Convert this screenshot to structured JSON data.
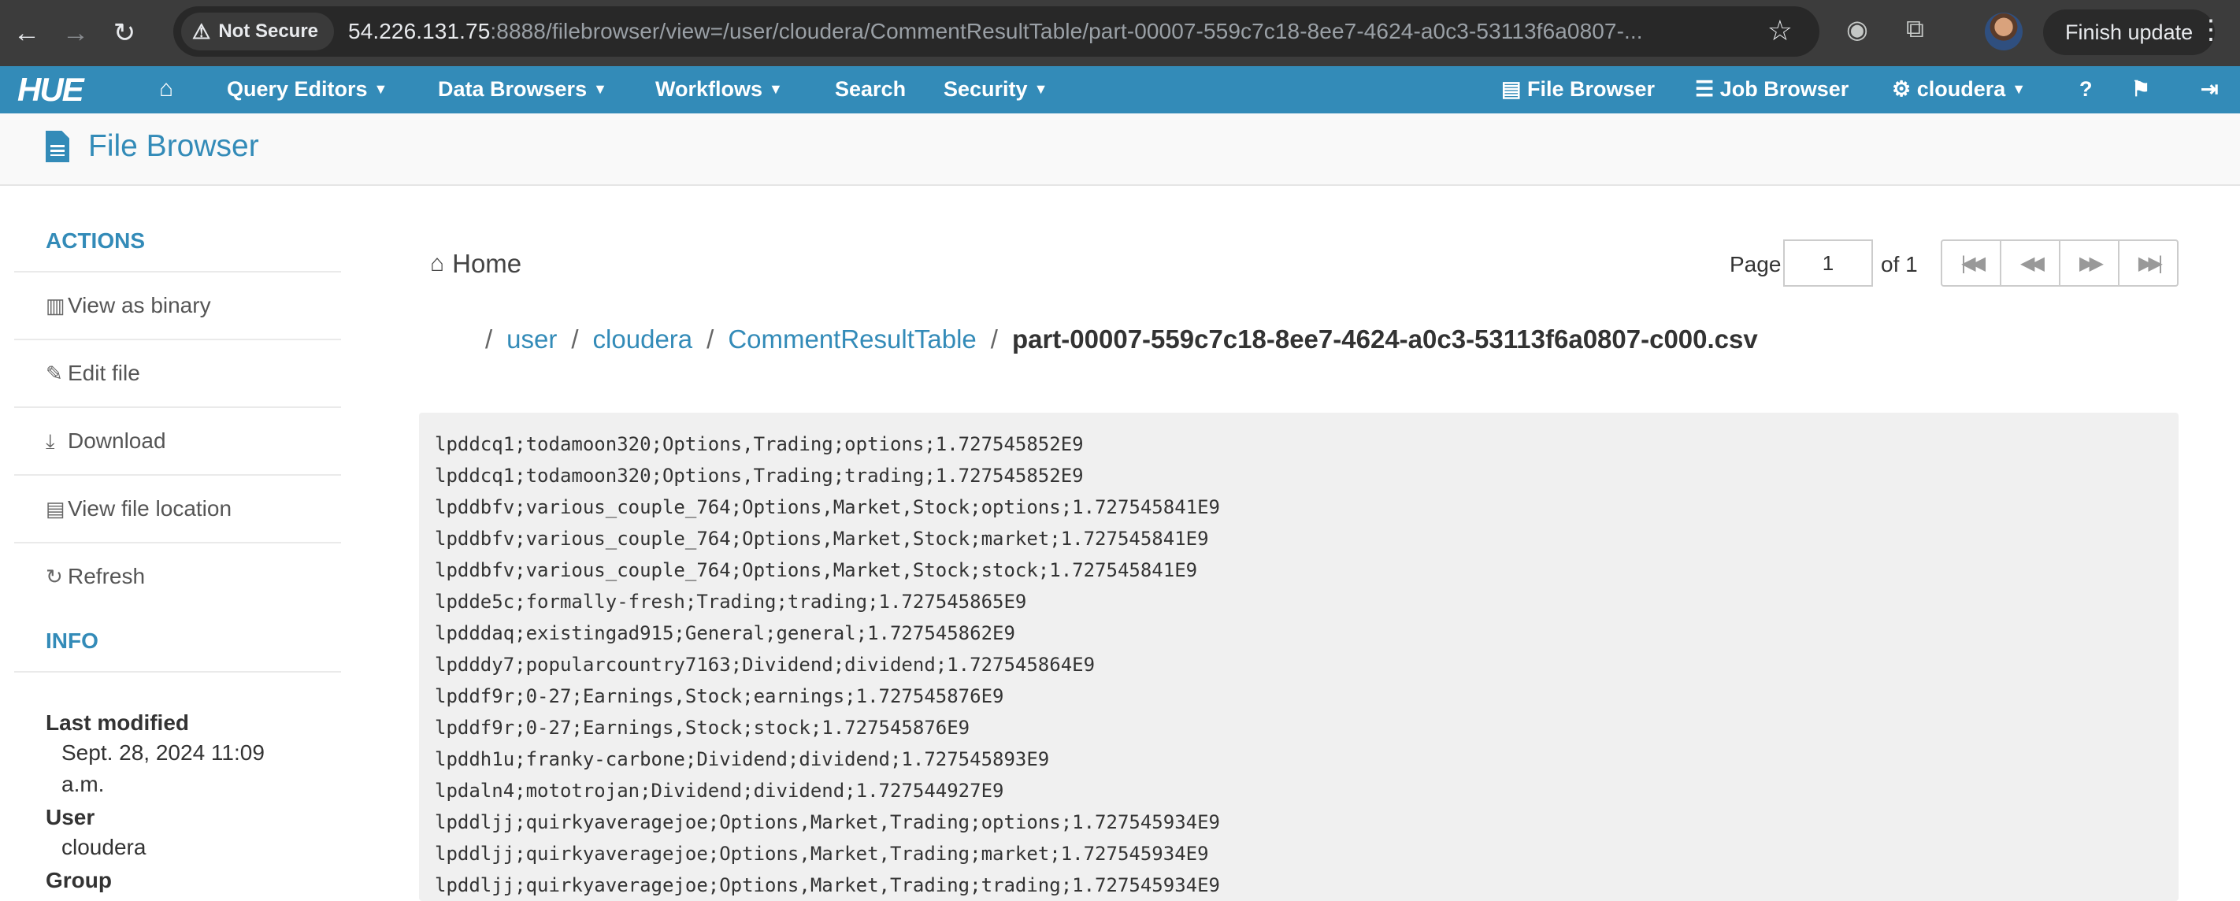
{
  "browser": {
    "security_label": "Not Secure",
    "url_host": "54.226.131.75",
    "url_rest": ":8888/filebrowser/view=/user/cloudera/CommentResultTable/part-00007-559c7c18-8ee7-4624-a0c3-53113f6a0807-...",
    "update_button": "Finish update"
  },
  "hue_nav": {
    "logo": "HUE",
    "query_editors": "Query Editors",
    "data_browsers": "Data Browsers",
    "workflows": "Workflows",
    "search": "Search",
    "security": "Security",
    "file_browser": "File Browser",
    "job_browser": "Job Browser",
    "user": "cloudera"
  },
  "page": {
    "title": "File Browser"
  },
  "sidebar": {
    "actions_heading": "ACTIONS",
    "actions": [
      "View as binary",
      "Edit file",
      "Download",
      "View file location",
      "Refresh"
    ],
    "info_heading": "INFO",
    "last_modified_label": "Last modified",
    "last_modified_value": "Sept. 28, 2024 11:09 a.m.",
    "user_label": "User",
    "user_value": "cloudera",
    "group_label": "Group"
  },
  "breadcrumb": {
    "home": "Home",
    "segments": [
      "user",
      "cloudera",
      "CommentResultTable"
    ],
    "current": "part-00007-559c7c18-8ee7-4624-a0c3-53113f6a0807-c000.csv"
  },
  "pager": {
    "page_label": "Page",
    "page_value": "1",
    "of_label": "of 1"
  },
  "file_lines": [
    "lpddcq1;todamoon320;Options,Trading;options;1.727545852E9",
    "lpddcq1;todamoon320;Options,Trading;trading;1.727545852E9",
    "lpddbfv;various_couple_764;Options,Market,Stock;options;1.727545841E9",
    "lpddbfv;various_couple_764;Options,Market,Stock;market;1.727545841E9",
    "lpddbfv;various_couple_764;Options,Market,Stock;stock;1.727545841E9",
    "lpdde5c;formally-fresh;Trading;trading;1.727545865E9",
    "lpdddaq;existingad915;General;general;1.727545862E9",
    "lpdddy7;popularcountry7163;Dividend;dividend;1.727545864E9",
    "lpddf9r;0-27;Earnings,Stock;earnings;1.727545876E9",
    "lpddf9r;0-27;Earnings,Stock;stock;1.727545876E9",
    "lpddh1u;franky-carbone;Dividend;dividend;1.727545893E9",
    "lpdaln4;mototrojan;Dividend;dividend;1.727544927E9",
    "lpddljj;quirkyaveragejoe;Options,Market,Trading;options;1.727545934E9",
    "lpddljj;quirkyaveragejoe;Options,Market,Trading;market;1.727545934E9",
    "lpddljj;quirkyaveragejoe;Options,Market,Trading;trading;1.727545934E9"
  ]
}
